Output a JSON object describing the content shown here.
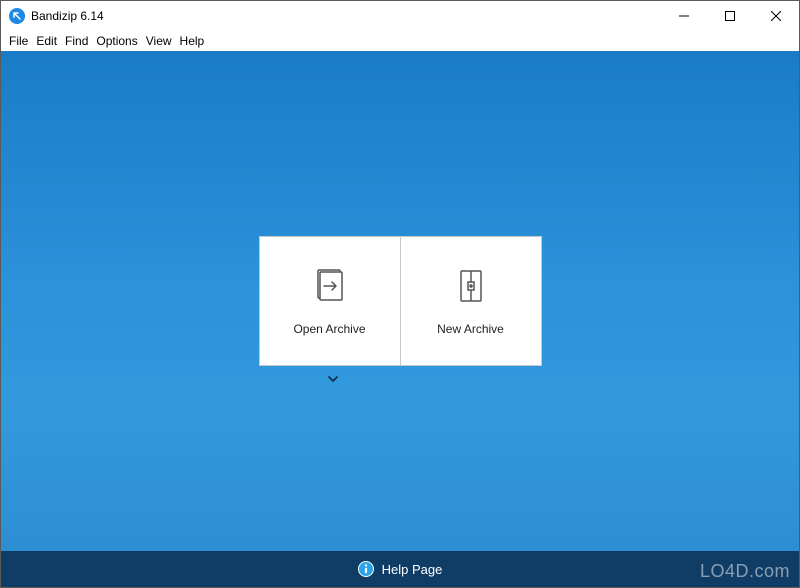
{
  "window": {
    "title": "Bandizip 6.14"
  },
  "menubar": {
    "items": [
      "File",
      "Edit",
      "Find",
      "Options",
      "View",
      "Help"
    ]
  },
  "actions": {
    "open_archive": "Open Archive",
    "new_archive": "New Archive"
  },
  "footer": {
    "help_page": "Help Page"
  },
  "watermark": "LO4D.com"
}
